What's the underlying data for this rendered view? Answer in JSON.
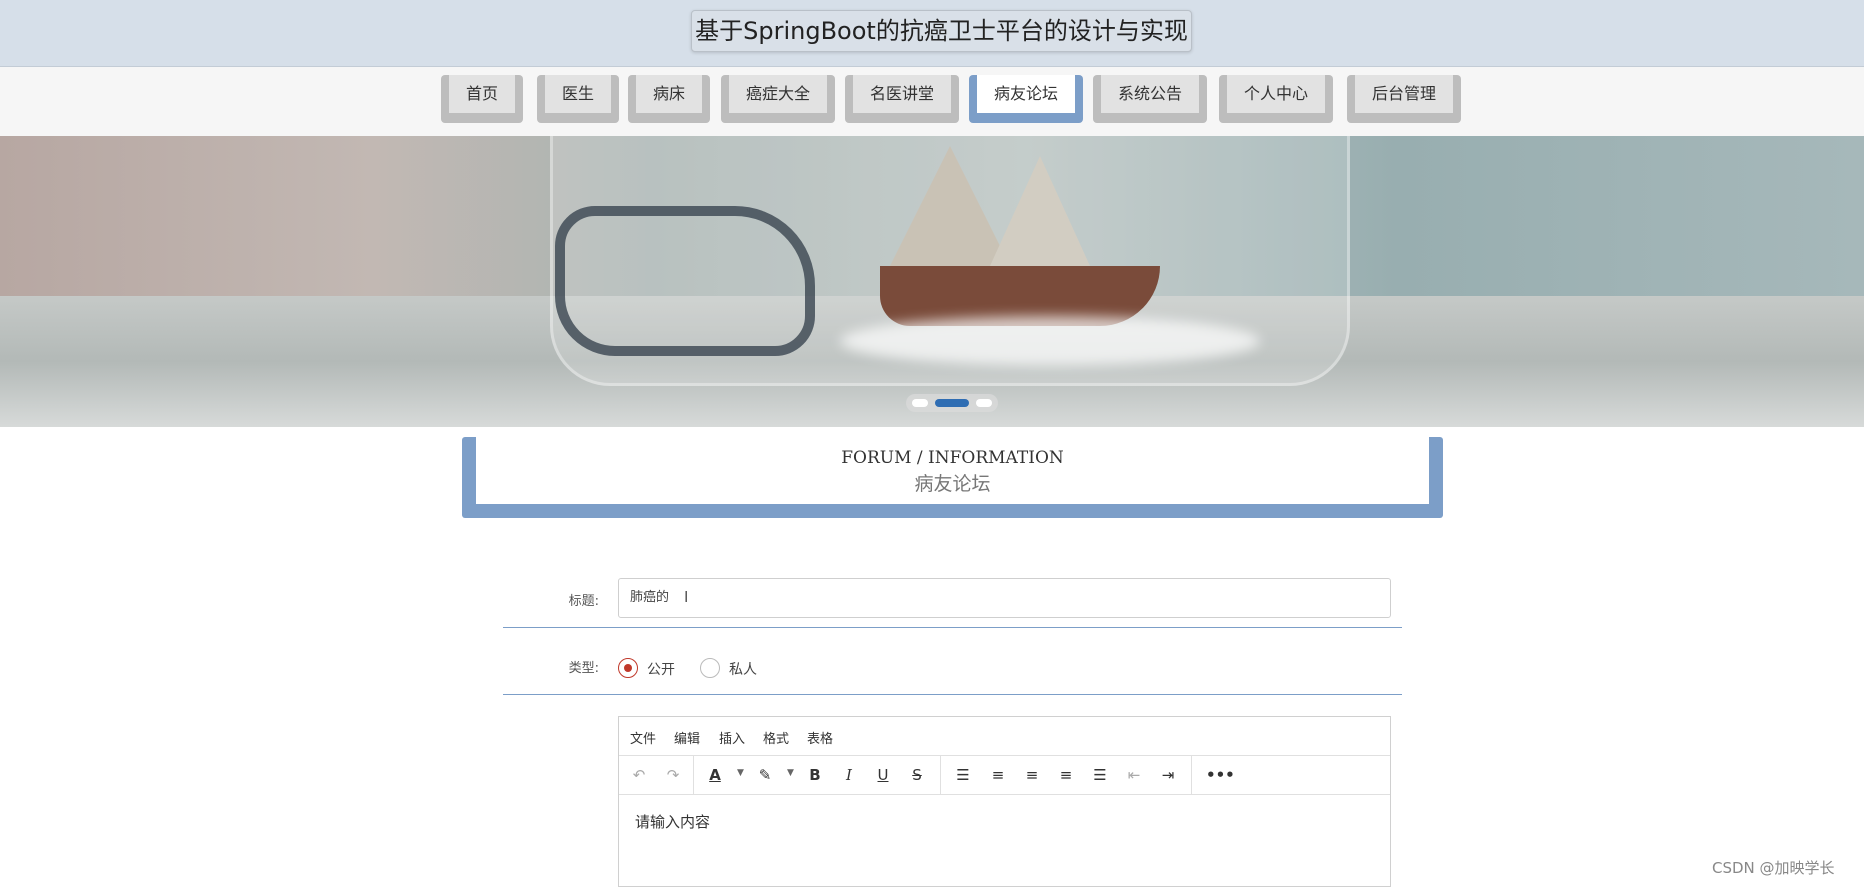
{
  "header": {
    "title": "基于SpringBoot的抗癌卫士平台的设计与实现"
  },
  "nav": {
    "items": [
      {
        "label": "首页"
      },
      {
        "label": "医生"
      },
      {
        "label": "病床"
      },
      {
        "label": "癌症大全"
      },
      {
        "label": "名医讲堂"
      },
      {
        "label": "病友论坛",
        "active": true
      },
      {
        "label": "系统公告"
      },
      {
        "label": "个人中心"
      },
      {
        "label": "后台管理"
      }
    ]
  },
  "carousel": {
    "slides": 3,
    "active_index": 1
  },
  "section": {
    "en": "FORUM / INFORMATION",
    "zh": "病友论坛"
  },
  "form": {
    "title_label": "标题:",
    "title_value": "肺癌的",
    "type_label": "类型:",
    "type_options": [
      {
        "label": "公开",
        "checked": true
      },
      {
        "label": "私人",
        "checked": false
      }
    ]
  },
  "editor": {
    "menu": [
      "文件",
      "编辑",
      "插入",
      "格式",
      "表格"
    ],
    "placeholder": "请输入内容",
    "toolbar_icons": [
      "undo-icon",
      "redo-icon",
      "text-color-icon",
      "highlight-icon",
      "bold-icon",
      "italic-icon",
      "underline-icon",
      "strikethrough-icon",
      "line-height-icon",
      "align-left-icon",
      "align-center-icon",
      "align-right-icon",
      "align-justify-icon",
      "outdent-icon",
      "indent-icon",
      "more-icon"
    ]
  },
  "watermark": "CSDN @加映学长",
  "colors": {
    "accent": "#7c9ec8",
    "radio_checked": "#c0392b",
    "header_bg": "#d6dfe9"
  }
}
